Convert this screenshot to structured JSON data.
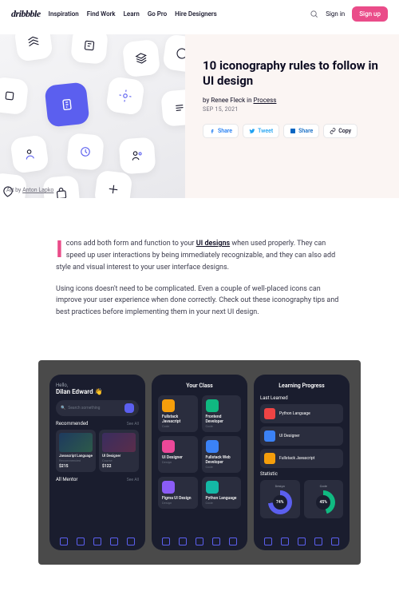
{
  "header": {
    "logo": "dribbble",
    "nav": [
      "Inspiration",
      "Find Work",
      "Learn",
      "Go Pro",
      "Hire Designers"
    ],
    "signin": "Sign in",
    "signup": "Sign up"
  },
  "hero": {
    "credit_prefix": "Art by ",
    "credit_name": "Anton Lapko",
    "title": "10 iconography rules to follow in UI design",
    "by_prefix": "by ",
    "author": "Renee Fleck",
    "in_text": " in ",
    "category": "Process",
    "date": "SEP 15, 2021",
    "share": {
      "fb": "Share",
      "tw": "Tweet",
      "li": "Share",
      "cp": "Copy"
    }
  },
  "article": {
    "dropcap": "I",
    "p1a": "cons add both form and function to your ",
    "p1_link": "UI designs",
    "p1b": " when used properly. They can speed up user interactions by being immediately recognizable, and they can also add style and visual interest to your user interface designs.",
    "p2": "Using icons doesn't need to be complicated. Even a couple of well-placed icons can improve your user experience when done correctly. Check out these iconography tips and best practices before implementing them in your next UI design."
  },
  "phones": {
    "p1": {
      "greet": "Hello,",
      "name": "Dilan Edward 👋",
      "search": "Search something",
      "rec": "Recommended",
      "all": "See All",
      "c1t": "Javascript Language",
      "c1s": "Recommended",
      "c1p": "$215",
      "c2t": "UI Designer",
      "c2s": "Course",
      "c2p": "$122",
      "mentor": "All Mentor"
    },
    "p2": {
      "title": "Your Class",
      "g": [
        {
          "t": "Fullstack Javascript",
          "s": "Code"
        },
        {
          "t": "Frontend Developer",
          "s": "Code"
        },
        {
          "t": "UI Designer",
          "s": "Design"
        },
        {
          "t": "Fullstack Web Developer",
          "s": "Code"
        },
        {
          "t": "Figma UI Design",
          "s": "Design"
        },
        {
          "t": "Python Language",
          "s": "Code"
        }
      ]
    },
    "p3": {
      "title": "Learning Progress",
      "last": "Last Learned",
      "items": [
        {
          "t": "Python Language"
        },
        {
          "t": "UI Designer"
        },
        {
          "t": "Fullstack Javascript"
        }
      ],
      "stat": "Statistic",
      "d1l": "Design",
      "d1v": "74%",
      "d2l": "Code",
      "d2v": "45%"
    }
  }
}
